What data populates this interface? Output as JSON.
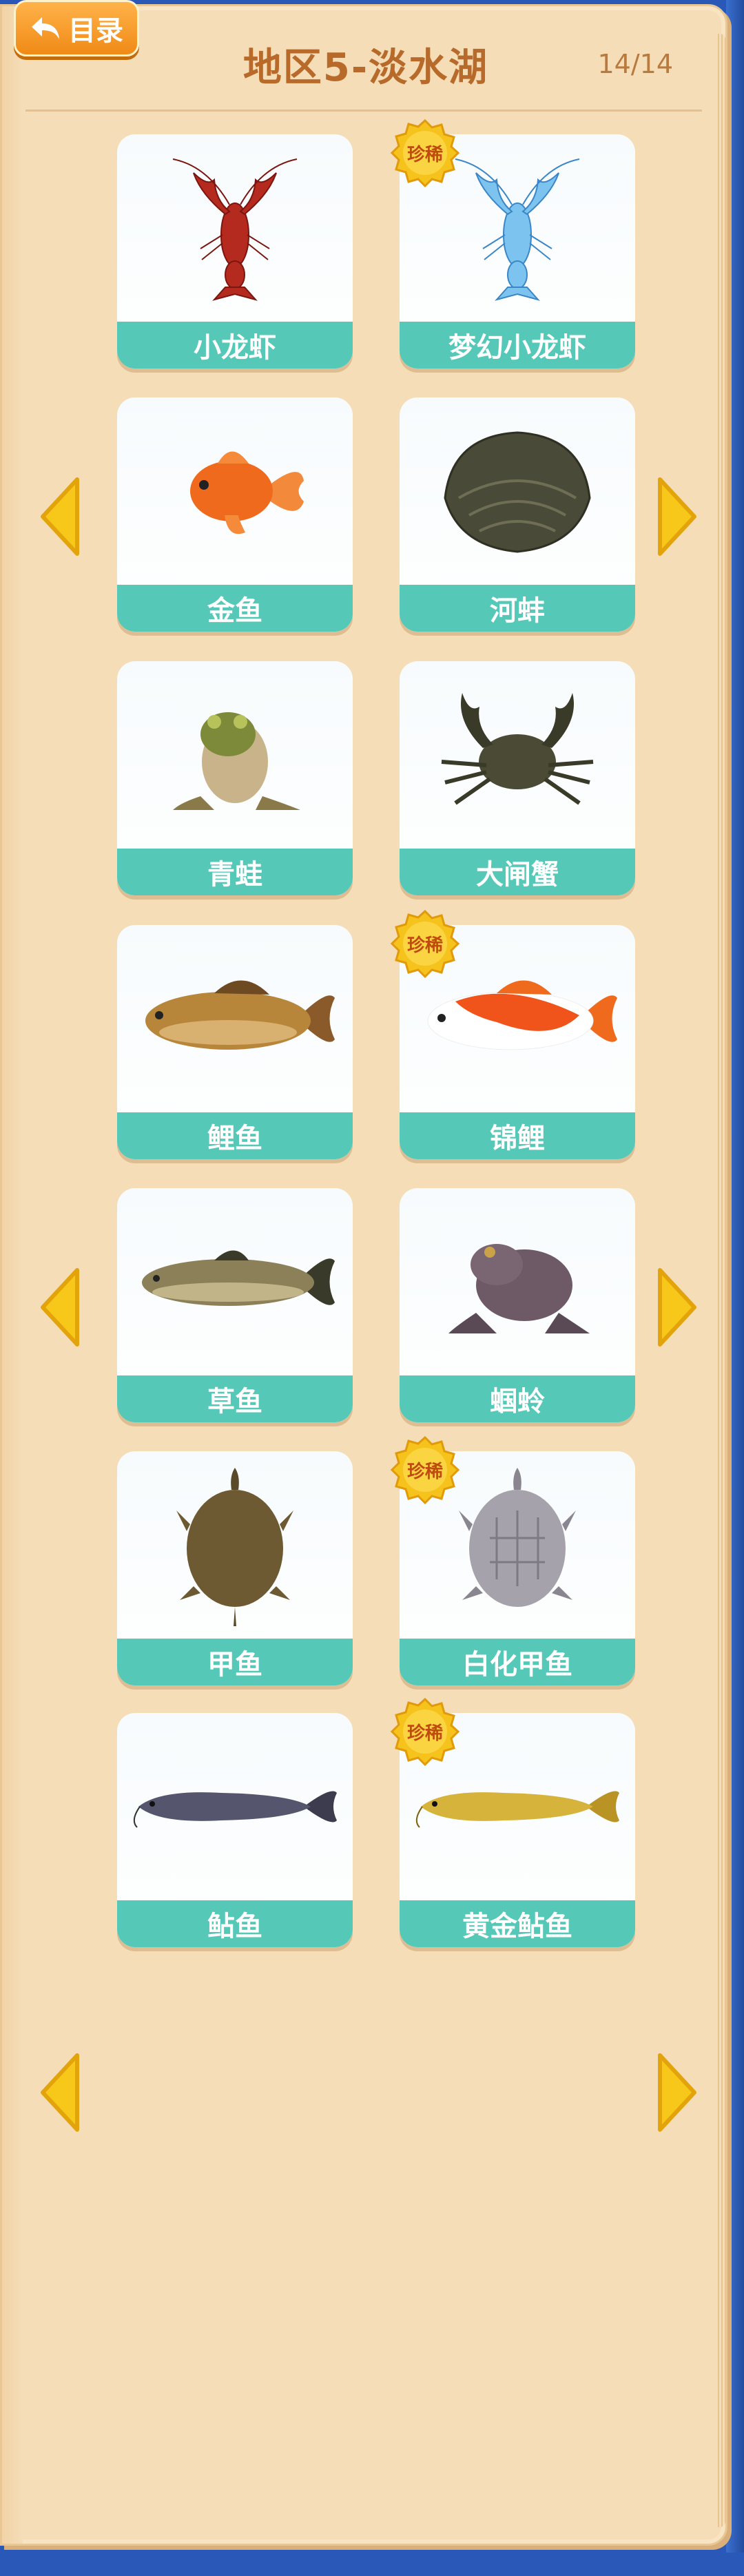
{
  "header": {
    "back_label": "目录",
    "title": "地区5-淡水湖",
    "page_count": "14/14"
  },
  "rare_label": "珍稀",
  "cards": [
    {
      "name": "小龙虾",
      "rare": false,
      "icon": "crayfish-icon"
    },
    {
      "name": "梦幻小龙虾",
      "rare": true,
      "icon": "blue-crayfish-icon"
    },
    {
      "name": "金鱼",
      "rare": false,
      "icon": "goldfish-icon"
    },
    {
      "name": "河蚌",
      "rare": false,
      "icon": "clam-icon"
    },
    {
      "name": "青蛙",
      "rare": false,
      "icon": "frog-icon"
    },
    {
      "name": "大闸蟹",
      "rare": false,
      "icon": "crab-icon"
    },
    {
      "name": "鲤鱼",
      "rare": false,
      "icon": "carp-icon"
    },
    {
      "name": "锦鲤",
      "rare": true,
      "icon": "koi-icon"
    },
    {
      "name": "草鱼",
      "rare": false,
      "icon": "grass-carp-icon"
    },
    {
      "name": "蝈蛉",
      "rare": false,
      "icon": "toad-icon"
    },
    {
      "name": "甲鱼",
      "rare": false,
      "icon": "softshell-turtle-icon"
    },
    {
      "name": "白化甲鱼",
      "rare": true,
      "icon": "albino-turtle-icon"
    },
    {
      "name": "鲇鱼",
      "rare": false,
      "icon": "catfish-icon"
    },
    {
      "name": "黄金鲇鱼",
      "rare": true,
      "icon": "golden-catfish-icon"
    }
  ],
  "colors": {
    "card_label": "#55c8b7",
    "title": "#b86a2a",
    "arrow": "#f7c81a",
    "back_button": "#f29a20"
  }
}
